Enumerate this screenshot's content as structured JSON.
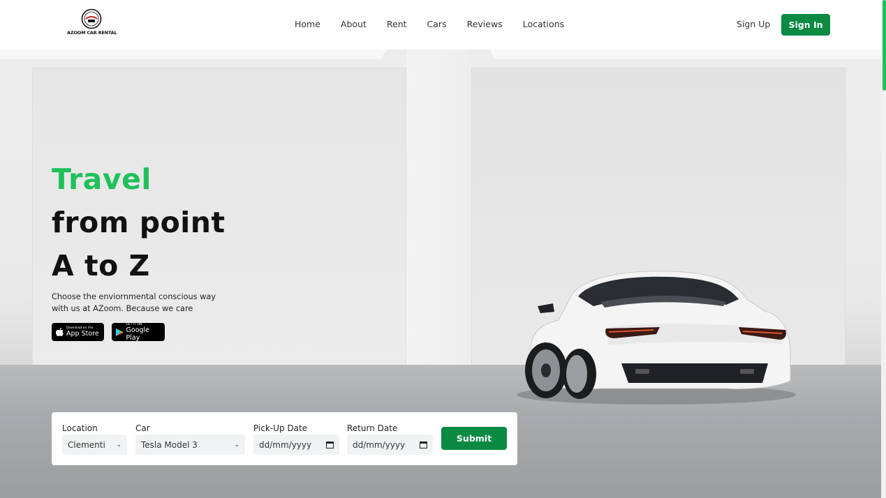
{
  "brand": {
    "name": "AZOOM CAR RENTAL"
  },
  "nav": {
    "links": [
      "Home",
      "About",
      "Rent",
      "Cars",
      "Reviews",
      "Locations"
    ],
    "signup": "Sign Up",
    "signin": "Sign In"
  },
  "hero": {
    "headline_line1": "Travel",
    "headline_line2": "from point",
    "headline_line3": "A to Z",
    "tagline": "Choose the enviornmental conscious way with us at AZoom. Because we care",
    "appstore_small": "Download on the",
    "appstore_big": "App Store",
    "googleplay_small": "GET IT ON",
    "googleplay_big": "Google Play"
  },
  "booking": {
    "location_label": "Location",
    "location_value": "Clementi",
    "car_label": "Car",
    "car_value": "Tesla Model 3",
    "pickup_label": "Pick-Up Date",
    "pickup_value": "dd/mm/yyyy",
    "return_label": "Return Date",
    "return_value": "dd/mm/yyyy",
    "submit_label": "Submit"
  },
  "colors": {
    "accent": "#20c05c",
    "button": "#0a8a43"
  }
}
